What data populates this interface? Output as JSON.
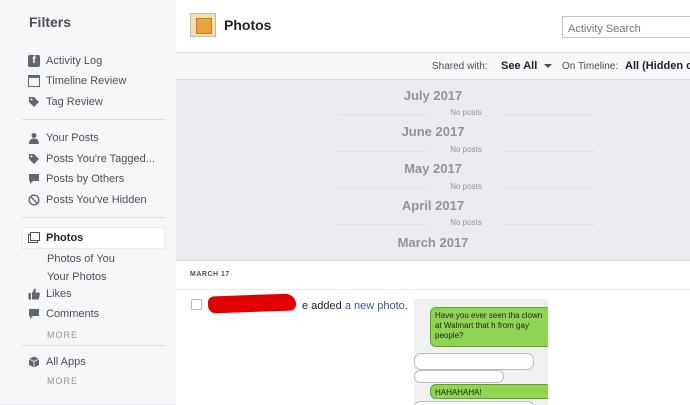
{
  "sidebar": {
    "title": "Filters",
    "group1": [
      {
        "label": "Activity Log",
        "icon": "facebook-f-icon"
      },
      {
        "label": "Timeline Review",
        "icon": "timeline-icon"
      },
      {
        "label": "Tag Review",
        "icon": "tag-icon"
      }
    ],
    "group2": [
      {
        "label": "Your Posts",
        "icon": "person-icon"
      },
      {
        "label": "Posts You're Tagged...",
        "icon": "tag-icon"
      },
      {
        "label": "Posts by Others",
        "icon": "speech-bubble-icon"
      },
      {
        "label": "Posts You've Hidden",
        "icon": "hidden-icon"
      }
    ],
    "photos": {
      "label": "Photos",
      "icon": "photos-icon"
    },
    "photos_sub": [
      "Photos of You",
      "Your Photos"
    ],
    "likes": {
      "label": "Likes",
      "icon": "thumbs-up-icon"
    },
    "comments": {
      "label": "Comments",
      "icon": "comment-icon"
    },
    "more1": "MORE",
    "all_apps": {
      "label": "All Apps",
      "icon": "cube-icon"
    },
    "more2": "MORE"
  },
  "header": {
    "title": "Photos",
    "search_placeholder": "Activity Search"
  },
  "filterbar": {
    "shared_label": "Shared with:",
    "shared_value": "See All",
    "timeline_label": "On Timeline:",
    "timeline_value": "All (Hidden c"
  },
  "months": [
    {
      "name": "July 2017",
      "note": "No posts"
    },
    {
      "name": "June 2017",
      "note": "No posts"
    },
    {
      "name": "May 2017",
      "note": "No posts"
    },
    {
      "name": "April 2017",
      "note": "No posts"
    },
    {
      "name": "March 2017",
      "note": ""
    }
  ],
  "post": {
    "date": "MARCH 17",
    "text_before": "e added ",
    "link": "a new photo",
    "text_after": ".",
    "photo": {
      "bubble1": "Have you ever seen tha clown at Walmart that h from gay people?",
      "bubble2": "HAHAHAHA!"
    }
  },
  "colors": {
    "link": "#365899",
    "redaction": "#e10000",
    "bubble_green": "#8fd452"
  }
}
